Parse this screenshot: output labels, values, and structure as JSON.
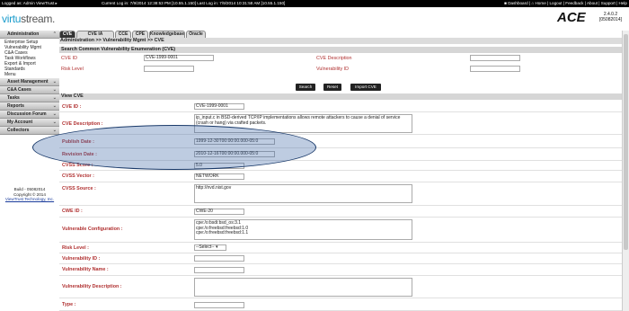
{
  "topbar": {
    "left": "Logged as: Admin ViewTrust ▸",
    "center": "Current Log in: 7/9/2014 12:38:53 PM [10.55.1.150]  Last Log in: 7/9/2014 10:31:58 AM [10.55.1.150]",
    "right": "■ Dashboard | ⌂ Home | Logout | Feedback | About | Support | Help"
  },
  "logo": {
    "v": "virtu",
    "rest": "stream."
  },
  "app": {
    "name": "ACE",
    "version": "2.4.0.2",
    "build": "[05082014]"
  },
  "sidebar": {
    "administration": "Administration",
    "admin_items": [
      "Enterprise Setup",
      "Vulnerability Mgmt",
      "C&A Cases",
      "Task Workflows",
      "Export & Import",
      "Standards",
      "Menu"
    ],
    "sections": [
      "Asset Management",
      "C&A Cases",
      "Tasks",
      "Reports",
      "Discussion Forum",
      "My Account",
      "Collectors"
    ],
    "build_lines": [
      "Build - 05082014",
      "Copyright © 2014"
    ],
    "company": "ViewTrust Technology, Inc."
  },
  "tabs": [
    "CVE",
    "CVE IA Mappings",
    "CCE",
    "CPE",
    "Knowledgebase",
    "Oracle"
  ],
  "breadcrumb": "Administration >> Vulnerability Mgmt >> CVE",
  "search": {
    "title": "Search Common Vulnerability Enumeration (CVE)",
    "cve_id_label": "CVE ID",
    "cve_id_value": "CVE-1999-0001",
    "risk_level_label": "Risk Level",
    "desc_label": "CVE Description",
    "vuln_id_label": "Vulnerability ID",
    "buttons": [
      "Search",
      "Reset",
      "Import CVE"
    ]
  },
  "view": {
    "title": "View CVE",
    "fields": [
      {
        "label": "CVE ID :",
        "value": "CVE-1999-0001"
      },
      {
        "label": "CVE Description :",
        "value": "ip_input.c in BSD-derived TCP/IP implementations allows remote attackers to cause a denial of service (crash or hang) via crafted packets."
      },
      {
        "label": "Publish Date :",
        "value": "1999-12-30T00:00:00.000-05:0"
      },
      {
        "label": "Revision Date :",
        "value": "2010-12-16T00:00:00.000-05:0"
      },
      {
        "label": "CVSS Score :",
        "value": "5.0"
      },
      {
        "label": "CVSS Vector :",
        "value": "NETWORK"
      },
      {
        "label": "CVSS Source :",
        "value": "http://nvd.nist.gov"
      },
      {
        "label": "CWE ID :",
        "value": "CWE-20"
      },
      {
        "label": "Vulnerable Configuration :",
        "value": [
          "cpe:/o:bsdi:bsd_os:3.1",
          "cpe:/o:freebsd:freebsd:1.0",
          "cpe:/o:freebsd:freebsd:1.1"
        ]
      },
      {
        "label": "Risk Level :",
        "value": "--Select-- ▾"
      },
      {
        "label": "Vulnerability ID :",
        "value": ""
      },
      {
        "label": "Vulnerability Name :",
        "value": ""
      },
      {
        "label": "Vulnerability Description :",
        "value": ""
      },
      {
        "label": "Type :",
        "value": ""
      }
    ]
  }
}
